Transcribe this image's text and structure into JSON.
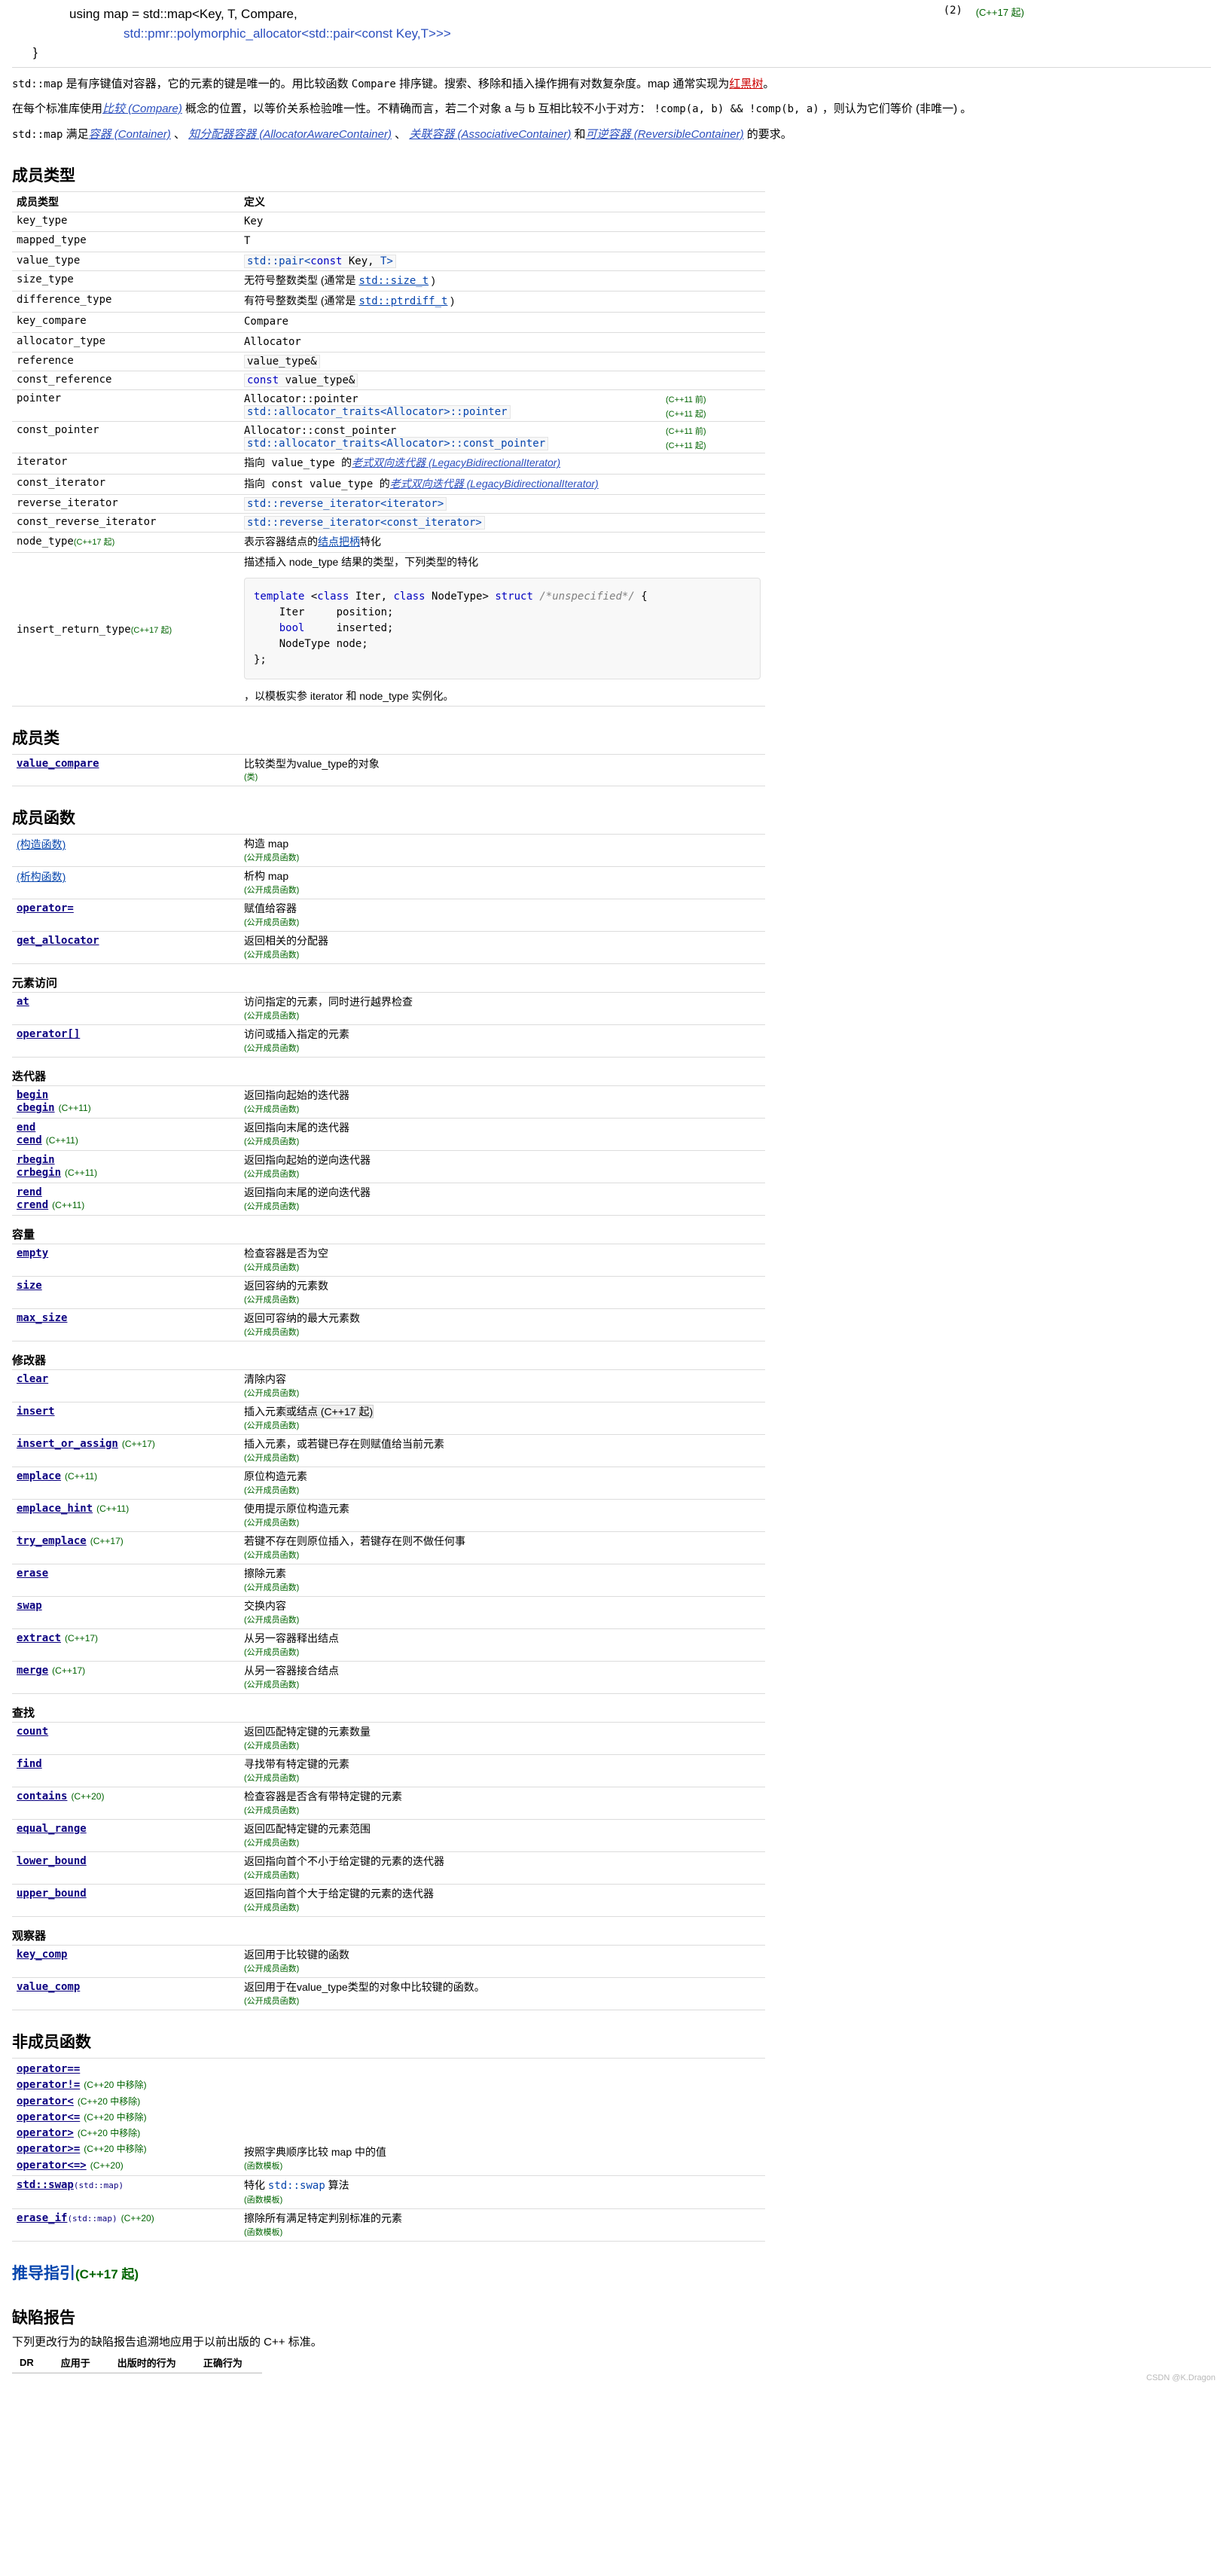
{
  "synopsis": {
    "line1": "using map = std::map<Key, T, Compare,",
    "line2": "std::pmr::polymorphic_allocator<std::pair<const Key,T>>>",
    "closing": "}",
    "number": "(2)",
    "version": "(C++17 起)"
  },
  "intro": {
    "p1_a": "std::map",
    "p1_b": " 是有序键值对容器，它的元素的键是唯一的。用比较函数 ",
    "p1_c": "Compare",
    "p1_d": " 排序键。搜索、移除和插入操作拥有对数复杂度。map 通常实现为",
    "p1_link": "红黑树",
    "p1_e": "。",
    "p2_a": "在每个标准库使用",
    "p2_link": "比较 (Compare)",
    "p2_b": " 概念的位置，以等价关系检验唯一性。不精确而言，若二个对象 a 与 b 互相比较不小于对方： ",
    "p2_code": "!comp(a, b) && !comp(b, a)",
    "p2_c": " ，则认为它们等价 (非唯一) 。",
    "p3_a": "std::map",
    "p3_b": " 满足",
    "p3_l1": "容器 (Container)",
    "p3_s1": " 、 ",
    "p3_l2": "知分配器容器 (AllocatorAwareContainer)",
    "p3_s2": " 、 ",
    "p3_l3": "关联容器 (AssociativeContainer)",
    "p3_s3": " 和",
    "p3_l4": "可逆容器 (ReversibleContainer)",
    "p3_c": " 的要求。"
  },
  "member_types": {
    "heading": "成员类型",
    "col1": "成员类型",
    "col2": "定义",
    "rows": [
      {
        "name": "key_type",
        "def_plain": "Key"
      },
      {
        "name": "mapped_type",
        "def_plain": "T"
      },
      {
        "name": "value_type",
        "def_code": "std::pair<const Key, T>"
      },
      {
        "name": "size_type",
        "def_plain": "无符号整数类型 (通常是 ",
        "def_link": "std::size_t",
        "def_tail": " )"
      },
      {
        "name": "difference_type",
        "def_plain": "有符号整数类型 (通常是 ",
        "def_link": "std::ptrdiff_t",
        "def_tail": " )"
      },
      {
        "name": "key_compare",
        "def_plain": "Compare"
      },
      {
        "name": "allocator_type",
        "def_plain": "Allocator"
      },
      {
        "name": "reference",
        "def_code": "value_type&"
      },
      {
        "name": "const_reference",
        "def_code_kw": "const",
        "def_code_rest": " value_type&"
      }
    ],
    "pointer": {
      "name": "pointer",
      "a": "Allocator::pointer",
      "a_ver": "(C++11 前)",
      "b_pre": "std::allocator_traits<Allocator>",
      "b_post": "::pointer",
      "b_ver": "(C++11 起)"
    },
    "const_pointer": {
      "name": "const_pointer",
      "a": "Allocator::const_pointer",
      "a_ver": "(C++11 前)",
      "b_pre": "std::allocator_traits<Allocator>",
      "b_post": "::const_pointer",
      "b_ver": "(C++11 起)"
    },
    "iterator": {
      "name": "iterator",
      "pre": "指向 value_type 的",
      "link": "老式双向迭代器 (LegacyBidirectionalIterator)"
    },
    "const_iterator": {
      "name": "const_iterator",
      "pre": "指向 const value_type 的",
      "link": "老式双向迭代器 (LegacyBidirectionalIterator)"
    },
    "reverse_iterator": {
      "name": "reverse_iterator",
      "code": "std::reverse_iterator<iterator>"
    },
    "const_reverse_iterator": {
      "name": "const_reverse_iterator",
      "code": "std::reverse_iterator<const_iterator>"
    },
    "node_type": {
      "name": "node_type",
      "ver": "(C++17 起)",
      "pre": "表示容器结点的",
      "link": "结点把柄",
      "post": "特化"
    },
    "insert_return_type": {
      "name": "insert_return_type",
      "ver": "(C++17 起)",
      "desc": "描述插入 node_type 结果的类型，下列类型的特化",
      "code_l1_kw": "template",
      "code_l1_b": " <",
      "code_l1_kw2": "class",
      "code_l1_c": " Iter, ",
      "code_l1_kw3": "class",
      "code_l1_d": " NodeType> ",
      "code_l1_kw4": "struct",
      "code_l1_cm": " /*unspecified*/",
      "code_l1_e": " {",
      "code_l2": "    Iter     position;",
      "code_l3_kw": "    bool",
      "code_l3": "     inserted;",
      "code_l4": "    NodeType node;",
      "code_l5": "};",
      "footer": "，以模板实参 iterator 和 node_type 实例化。"
    }
  },
  "member_class": {
    "heading": "成员类",
    "rows": [
      {
        "name": "value_compare",
        "desc": "比较类型为value_type的对象",
        "kind": "(类)"
      }
    ]
  },
  "member_functions": {
    "heading": "成员函数",
    "groups": [
      {
        "title": "",
        "rows": [
          {
            "name": "(构造函数)",
            "plain": true,
            "desc": "构造 map",
            "kind": "(公开成员函数)"
          },
          {
            "name": "(析构函数)",
            "plain": true,
            "desc": "析构 map",
            "kind": "(公开成员函数)"
          },
          {
            "name": "operator=",
            "desc": "赋值给容器",
            "kind": "(公开成员函数)"
          },
          {
            "name": "get_allocator",
            "desc": "返回相关的分配器",
            "kind": "(公开成员函数)"
          }
        ]
      },
      {
        "title": "元素访问",
        "rows": [
          {
            "name": "at",
            "desc": "访问指定的元素，同时进行越界检查",
            "kind": "(公开成员函数)"
          },
          {
            "name": "operator[]",
            "desc": "访问或插入指定的元素",
            "kind": "(公开成员函数)"
          }
        ]
      },
      {
        "title": "迭代器",
        "rows": [
          {
            "name": "begin",
            "name2": "cbegin",
            "ver2": "(C++11)",
            "desc": "返回指向起始的迭代器",
            "kind": "(公开成员函数)"
          },
          {
            "name": "end",
            "name2": "cend",
            "ver2": "(C++11)",
            "desc": "返回指向末尾的迭代器",
            "kind": "(公开成员函数)"
          },
          {
            "name": "rbegin",
            "name2": "crbegin",
            "ver2": "(C++11)",
            "desc": "返回指向起始的逆向迭代器",
            "kind": "(公开成员函数)"
          },
          {
            "name": "rend",
            "name2": "crend",
            "ver2": "(C++11)",
            "desc": "返回指向末尾的逆向迭代器",
            "kind": "(公开成员函数)"
          }
        ]
      },
      {
        "title": "容量",
        "rows": [
          {
            "name": "empty",
            "desc": "检查容器是否为空",
            "kind": "(公开成员函数)"
          },
          {
            "name": "size",
            "desc": "返回容纳的元素数",
            "kind": "(公开成员函数)"
          },
          {
            "name": "max_size",
            "desc": "返回可容纳的最大元素数",
            "kind": "(公开成员函数)"
          }
        ]
      },
      {
        "title": "修改器",
        "rows": [
          {
            "name": "clear",
            "desc": "清除内容",
            "kind": "(公开成员函数)"
          },
          {
            "name": "insert",
            "desc": "插入元素",
            "desc_hl": "或结点 (C++17 起)",
            "kind": "(公开成员函数)"
          },
          {
            "name": "insert_or_assign",
            "ver": "(C++17)",
            "desc": "插入元素，或若键已存在则赋值给当前元素",
            "kind": "(公开成员函数)"
          },
          {
            "name": "emplace",
            "ver": "(C++11)",
            "desc": "原位构造元素",
            "kind": "(公开成员函数)"
          },
          {
            "name": "emplace_hint",
            "ver": "(C++11)",
            "desc": "使用提示原位构造元素",
            "kind": "(公开成员函数)"
          },
          {
            "name": "try_emplace",
            "ver": "(C++17)",
            "desc": "若键不存在则原位插入，若键存在则不做任何事",
            "kind": "(公开成员函数)"
          },
          {
            "name": "erase",
            "desc": "擦除元素",
            "kind": "(公开成员函数)"
          },
          {
            "name": "swap",
            "desc": "交换内容",
            "kind": "(公开成员函数)"
          },
          {
            "name": "extract",
            "ver": "(C++17)",
            "desc": "从另一容器释出结点",
            "kind": "(公开成员函数)"
          },
          {
            "name": "merge",
            "ver": "(C++17)",
            "desc": "从另一容器接合结点",
            "kind": "(公开成员函数)"
          }
        ]
      },
      {
        "title": "查找",
        "rows": [
          {
            "name": "count",
            "desc": "返回匹配特定键的元素数量",
            "kind": "(公开成员函数)"
          },
          {
            "name": "find",
            "desc": "寻找带有特定键的元素",
            "kind": "(公开成员函数)"
          },
          {
            "name": "contains",
            "ver": "(C++20)",
            "desc": "检查容器是否含有带特定键的元素",
            "kind": "(公开成员函数)"
          },
          {
            "name": "equal_range",
            "desc": "返回匹配特定键的元素范围",
            "kind": "(公开成员函数)"
          },
          {
            "name": "lower_bound",
            "desc": "返回指向首个不小于给定键的元素的迭代器",
            "kind": "(公开成员函数)"
          },
          {
            "name": "upper_bound",
            "desc": "返回指向首个大于给定键的元素的迭代器",
            "kind": "(公开成员函数)"
          }
        ]
      },
      {
        "title": "观察器",
        "rows": [
          {
            "name": "key_comp",
            "desc": "返回用于比较键的函数",
            "kind": "(公开成员函数)"
          },
          {
            "name": "value_comp",
            "desc": "返回用于在value_type类型的对象中比较键的函数。",
            "kind": "(公开成员函数)"
          }
        ]
      }
    ]
  },
  "non_member": {
    "heading": "非成员函数",
    "operators": [
      {
        "name": "operator==",
        "ver": ""
      },
      {
        "name": "operator!=",
        "ver": "(C++20 中移除)"
      },
      {
        "name": "operator<",
        "ver": "(C++20 中移除)"
      },
      {
        "name": "operator<=",
        "ver": "(C++20 中移除)"
      },
      {
        "name": "operator>",
        "ver": "(C++20 中移除)"
      },
      {
        "name": "operator>=",
        "ver": "(C++20 中移除)"
      },
      {
        "name": "operator<=>",
        "ver": "(C++20)"
      }
    ],
    "operators_desc": "按照字典顺序比较 map 中的值",
    "operators_kind": "(函数模板)",
    "rows": [
      {
        "name": "std::swap",
        "sub": "(std::map)",
        "desc_a": "特化 ",
        "desc_code": "std::swap",
        "desc_b": " 算法",
        "kind": "(函数模板)"
      },
      {
        "name": "erase_if",
        "sub": "(std::map)",
        "ver": "(C++20)",
        "desc_a": "擦除所有满足特定判别标准的元素",
        "kind": "(函数模板)"
      }
    ]
  },
  "deduction_guides": {
    "heading": "推导指引",
    "ver": "(C++17 起)"
  },
  "defect_reports": {
    "heading": "缺陷报告",
    "note": "下列更改行为的缺陷报告追溯地应用于以前出版的 C++ 标准。",
    "columns": [
      "DR",
      "应用于",
      "出版时的行为",
      "正确行为"
    ]
  },
  "watermark": "CSDN @K.Dragon"
}
